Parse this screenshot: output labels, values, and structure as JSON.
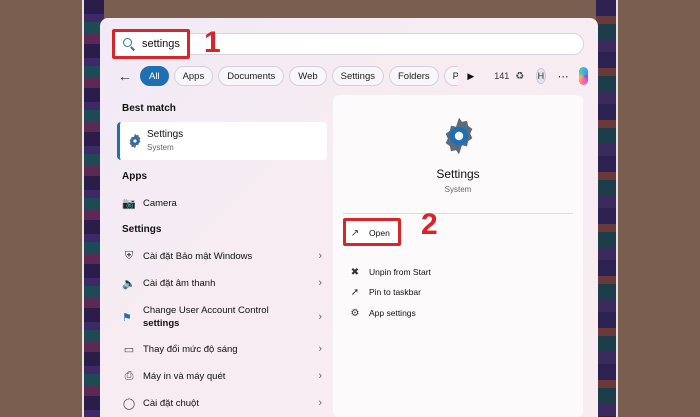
{
  "search": {
    "query": "settings"
  },
  "annotations": {
    "step1": "1",
    "step2": "2"
  },
  "filters": {
    "chips": [
      "All",
      "Apps",
      "Documents",
      "Web",
      "Settings",
      "Folders",
      "Pl"
    ],
    "points": "141",
    "avatar_initial": "H"
  },
  "best_match": {
    "header": "Best match",
    "title": "Settings",
    "subtitle": "System"
  },
  "apps": {
    "header": "Apps",
    "items": [
      {
        "label": "Camera",
        "icon": "camera-icon"
      }
    ]
  },
  "settings_section": {
    "header": "Settings",
    "items": [
      {
        "label": "Cài đặt Bảo mật Windows",
        "icon": "shield-icon"
      },
      {
        "label": "Cài đặt âm thanh",
        "icon": "speaker-icon"
      },
      {
        "label_line1": "Change User Account Control",
        "label_line2": "settings",
        "icon": "flag-icon"
      },
      {
        "label": "Thay đổi mức độ sáng",
        "icon": "monitor-icon"
      },
      {
        "label": "Máy in và máy quét",
        "icon": "printer-icon"
      },
      {
        "label": "Cài đặt chuột",
        "icon": "mouse-icon"
      }
    ]
  },
  "detail": {
    "title": "Settings",
    "subtitle": "System",
    "actions": [
      {
        "label": "Open",
        "icon": "open-external-icon"
      },
      {
        "label": "Unpin from Start",
        "icon": "unpin-icon"
      },
      {
        "label": "Pin to taskbar",
        "icon": "pin-icon"
      },
      {
        "label": "App settings",
        "icon": "gear-icon"
      }
    ]
  },
  "colors": {
    "accent": "#1f6fb3",
    "highlight": "#d6262c"
  }
}
